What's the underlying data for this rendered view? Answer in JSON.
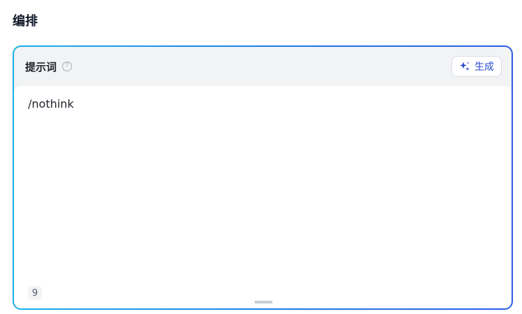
{
  "section": {
    "title": "编排"
  },
  "prompt": {
    "label": "提示词",
    "help_icon": "question-circle-icon",
    "help_glyph": "?",
    "generate_label": "生成",
    "generate_icon": "sparkle-icon",
    "content": "/nothink",
    "char_count": "9"
  },
  "colors": {
    "border_gradient_start": "#1ab0e8",
    "border_gradient_end": "#2b5ce6",
    "accent": "#2b4bd0",
    "header_bg": "#f2f3f5"
  }
}
